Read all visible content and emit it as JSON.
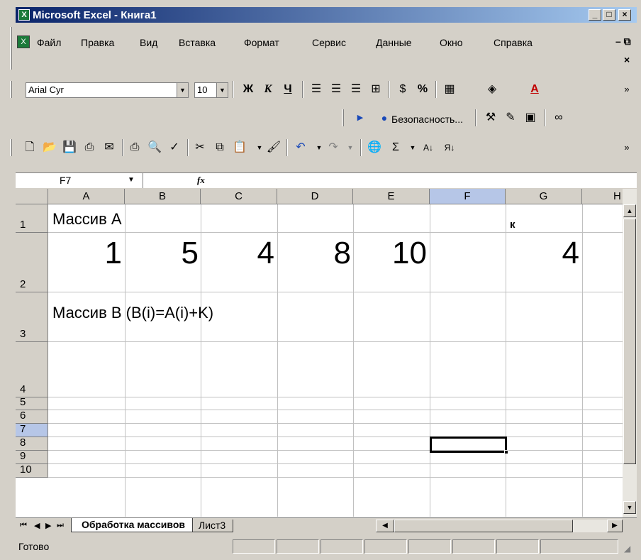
{
  "window": {
    "title": "Microsoft Excel - Книга1",
    "app_icon": "excel-icon"
  },
  "menu": {
    "items": [
      "Файл",
      "Правка",
      "Вид",
      "Вставка",
      "Формат",
      "Сервис",
      "Данные",
      "Окно",
      "Справка"
    ]
  },
  "formatting_toolbar": {
    "font_name": "Arial Cyr",
    "font_size": "10",
    "bold": "Ж",
    "italic": "К",
    "underline": "Ч",
    "percent": "%"
  },
  "security_toolbar": {
    "security_label": "Безопасность..."
  },
  "formula_bar": {
    "name_box": "F7",
    "fx": "fx"
  },
  "grid": {
    "columns": [
      "A",
      "B",
      "C",
      "D",
      "E",
      "F",
      "G",
      "H"
    ],
    "rows": [
      "1",
      "2",
      "3",
      "4",
      "5",
      "6",
      "7",
      "8",
      "9",
      "10"
    ],
    "cells": {
      "A1": "Массив А",
      "G1": "к",
      "A2": "1",
      "B2": "5",
      "C2": "4",
      "D2": "8",
      "E2": "10",
      "G2": "4",
      "A3": "Массив В (B(i)=A(i)+K)"
    },
    "selected_cell": "F7"
  },
  "sheets": {
    "tabs": [
      "Обработка массивов",
      "Лист3"
    ],
    "active": "Обработка массивов"
  },
  "status": {
    "text": "Готово"
  },
  "colors": {
    "titlebar_start": "#0a246a",
    "titlebar_end": "#a6caf0",
    "chrome": "#d4d0c8",
    "selected_header": "#b6c6e7"
  }
}
